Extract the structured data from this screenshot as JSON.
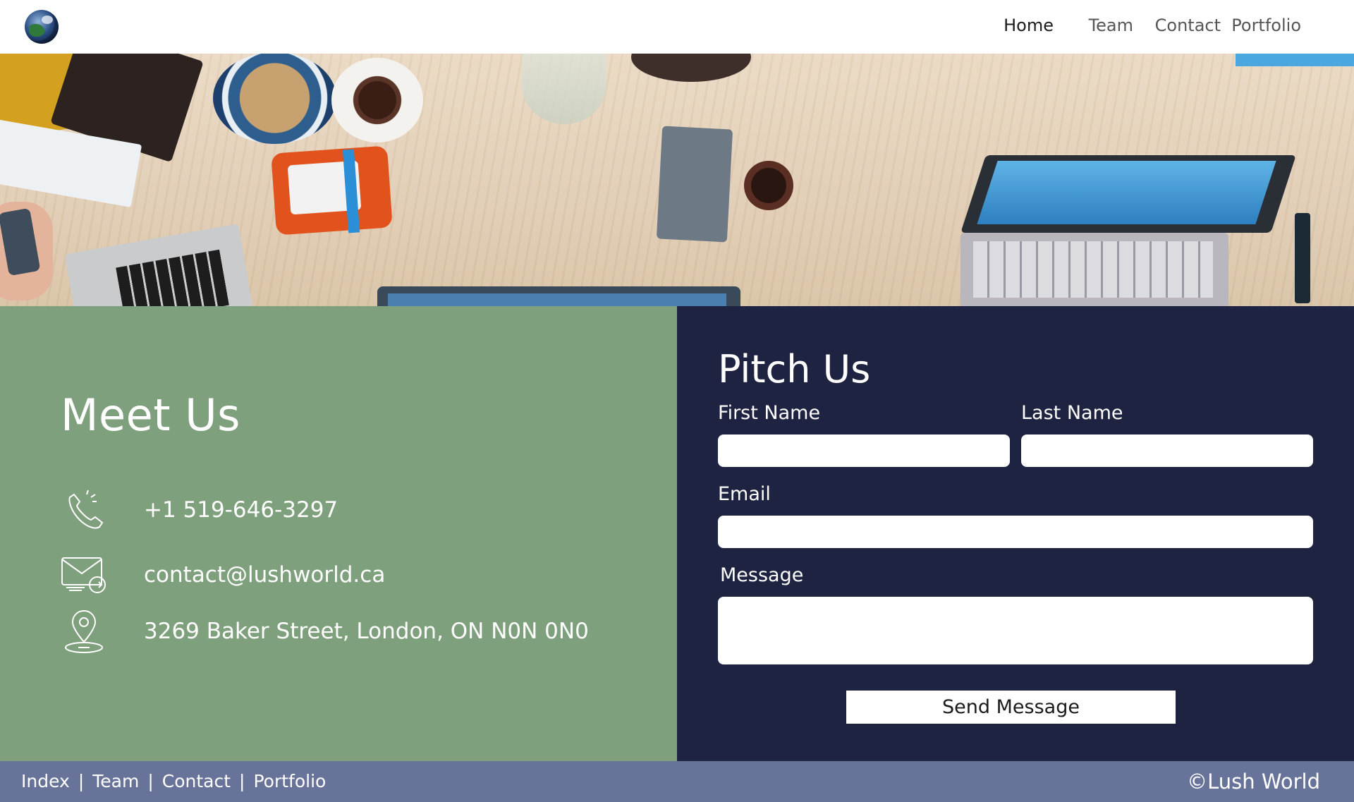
{
  "nav": {
    "logo_name": "globe-logo",
    "items": [
      {
        "label": "Home",
        "active": true
      },
      {
        "label": "Team",
        "active": false
      },
      {
        "label": "Contact",
        "active": false
      },
      {
        "label": "Portfolio",
        "active": false
      }
    ]
  },
  "hero": {
    "image_description_icon": "desk-workspace-photo"
  },
  "meet": {
    "title": "Meet Us",
    "phone": "+1 519-646-3297",
    "email": "contact@lushworld.ca",
    "address": "3269 Baker Street, London, ON N0N 0N0",
    "icons": [
      "phone-icon",
      "mail-icon",
      "location-pin-icon"
    ]
  },
  "pitch": {
    "title": "Pitch Us",
    "first_name_label": "First Name",
    "last_name_label": "Last Name",
    "email_label": "Email",
    "message_label": "Message",
    "first_name_value": "",
    "last_name_value": "",
    "email_value": "",
    "message_value": "",
    "send_label": "Send Message"
  },
  "footer": {
    "links": [
      "Index",
      "Team",
      "Contact",
      "Portfolio"
    ],
    "separator": "|",
    "copyright": "©Lush World"
  },
  "colors": {
    "meet_bg": "#7fa07c",
    "pitch_bg": "#1f2342",
    "footer_bg": "#687399"
  }
}
